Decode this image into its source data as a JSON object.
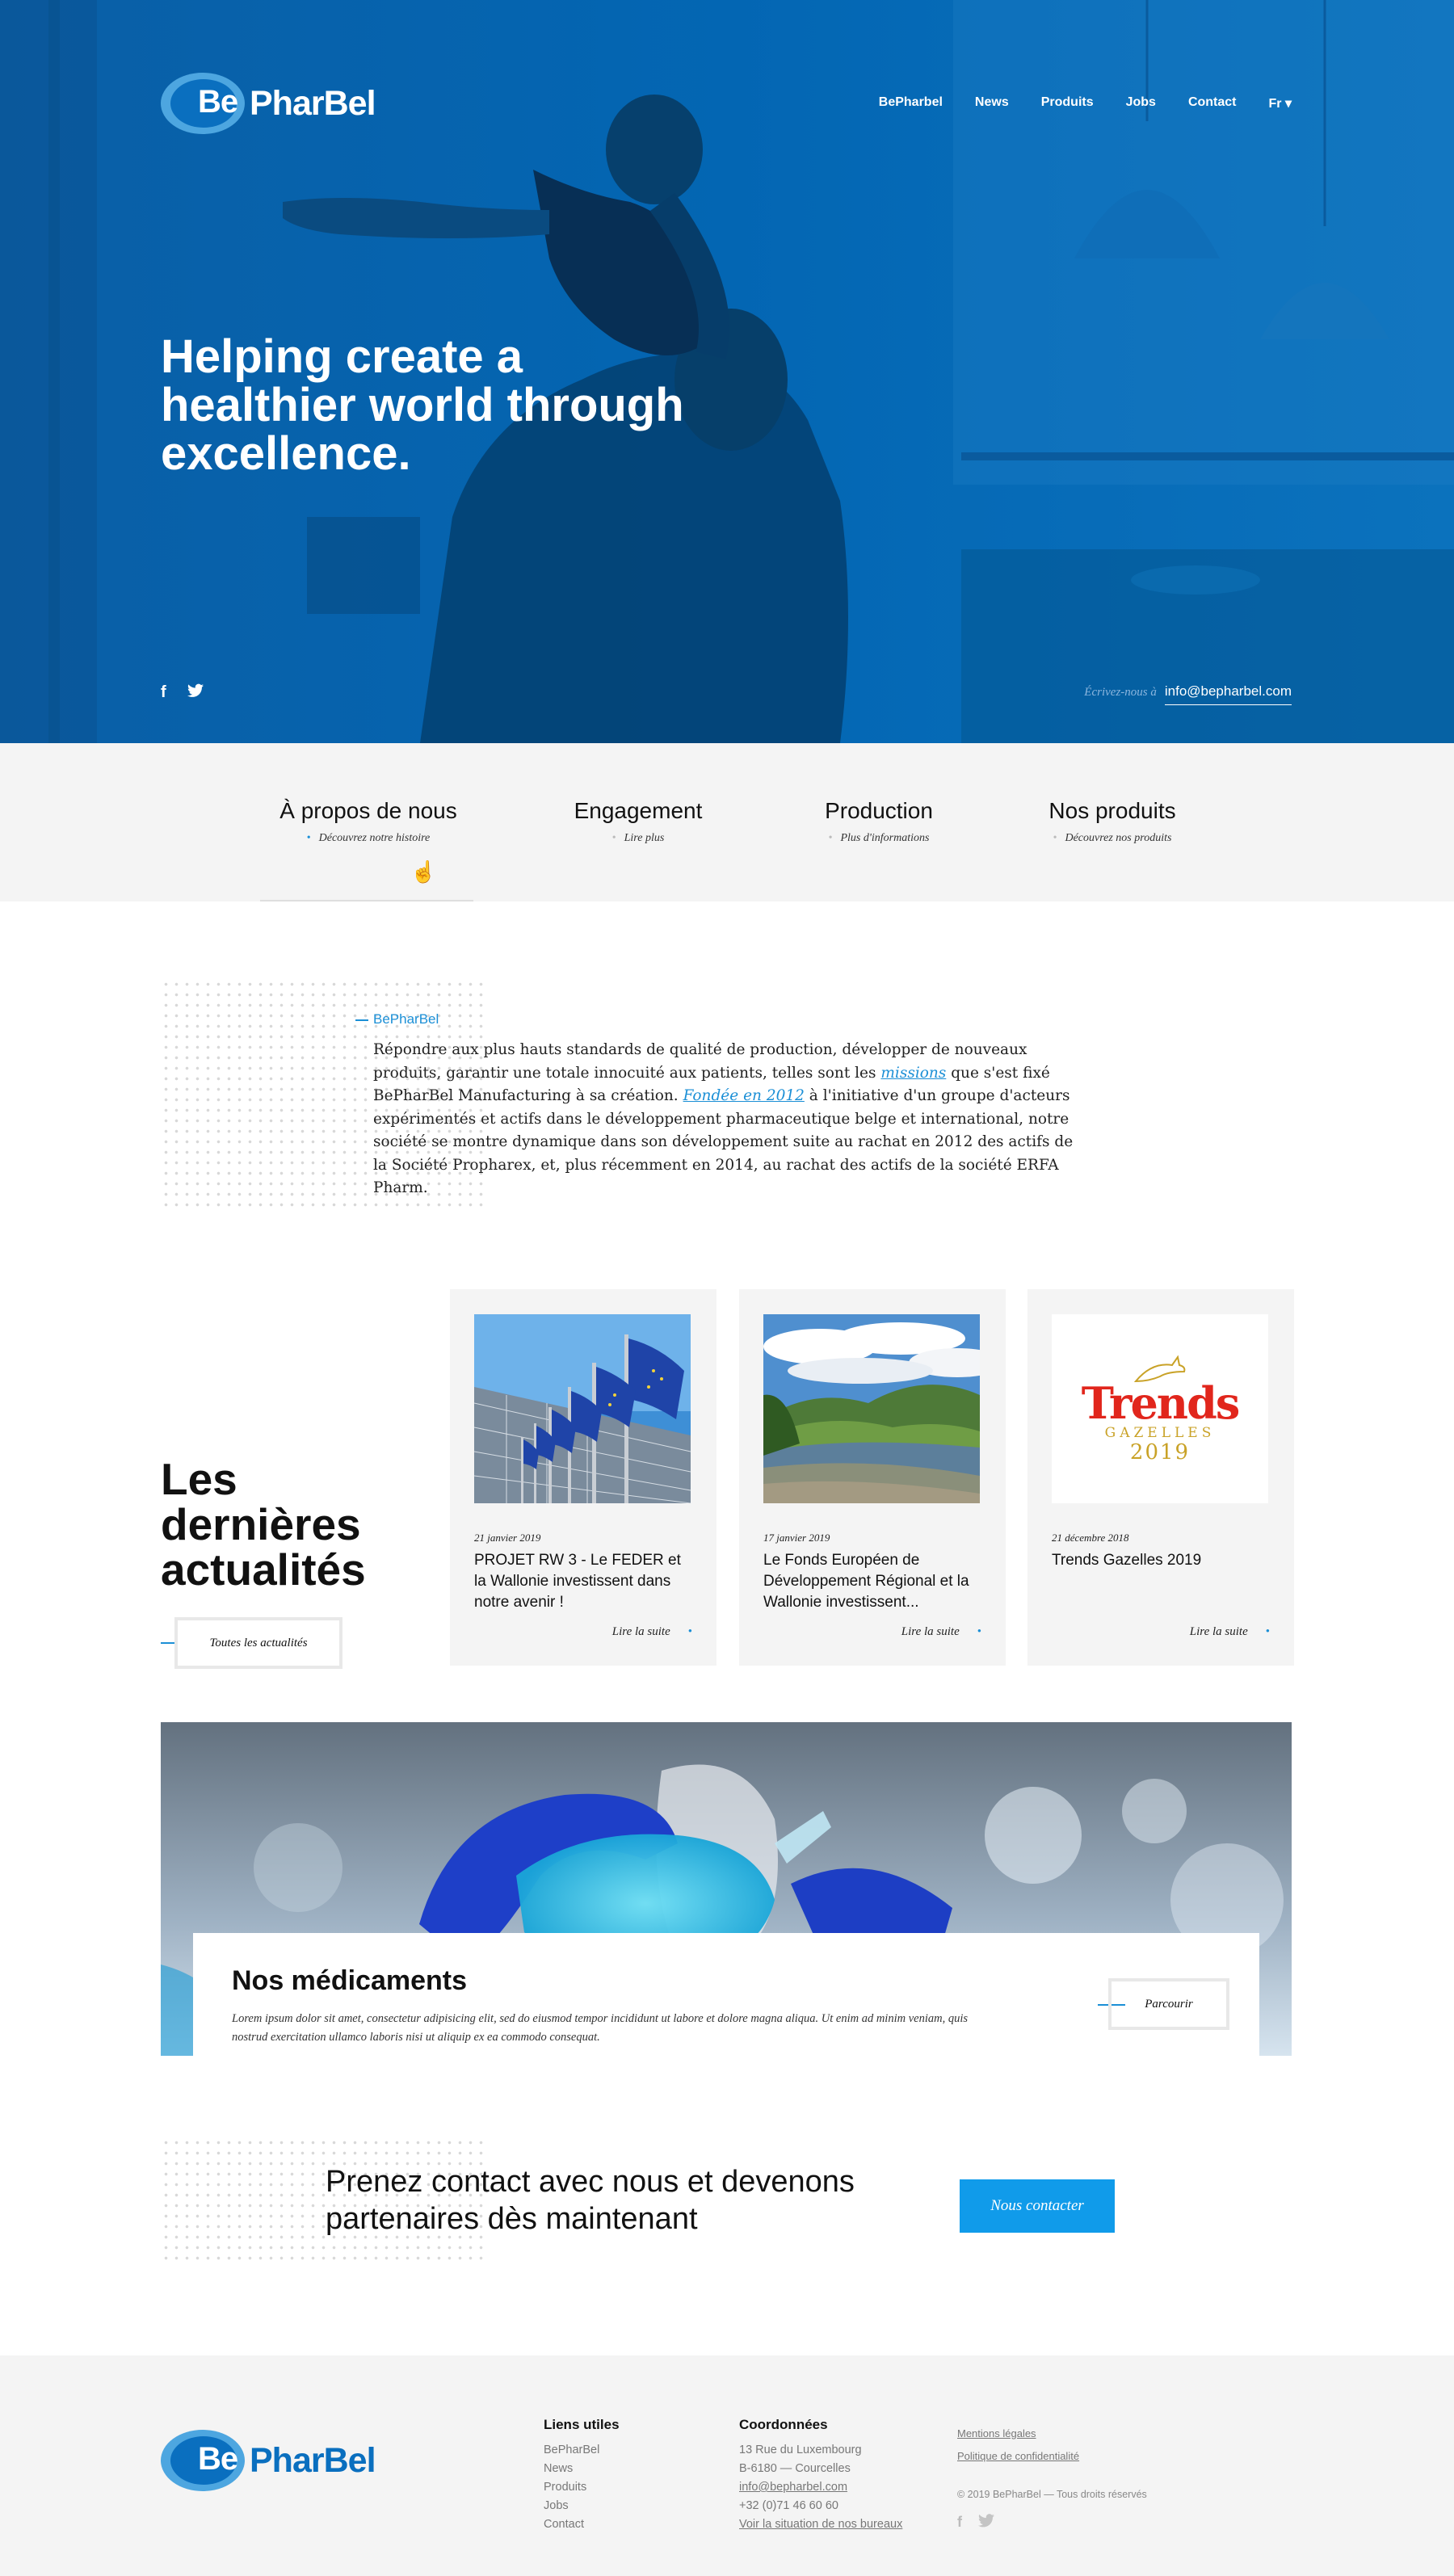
{
  "brand": {
    "be": "Be",
    "name": "PharBel",
    "primary_color": "#0366b3",
    "accent_color": "#1b8fd6",
    "button_color": "#109bea"
  },
  "nav": {
    "items": [
      "BePharbel",
      "News",
      "Produits",
      "Jobs",
      "Contact",
      "Fr ▾"
    ]
  },
  "hero": {
    "title": "Helping create a healthier world through excellence.",
    "social_icons": [
      "facebook-icon",
      "twitter-icon"
    ],
    "email_label": "Écrivez-nous à",
    "email": "info@bepharbel.com"
  },
  "features": [
    {
      "title": "À propos de nous",
      "subtitle": "Découvrez notre histoire",
      "active": true
    },
    {
      "title": "Engagement",
      "subtitle": "Lire plus",
      "active": false
    },
    {
      "title": "Production",
      "subtitle": "Plus d'informations",
      "active": false
    },
    {
      "title": "Nos produits",
      "subtitle": "Découvrez nos produits",
      "active": false
    }
  ],
  "about": {
    "kicker": "BePharBel",
    "text_1": "Répondre aux plus hauts standards de qualité de production, développer de nouveaux produits, garantir une totale innocuité aux patients, telles sont les ",
    "link_1": "missions",
    "text_2": " que s'est fixé BePharBel Manufacturing à sa création. ",
    "link_2": "Fondée en 2012",
    "text_3": " à l'initiative d'un groupe d'acteurs expérimentés et actifs dans le développement pharmaceutique belge et international, notre société se montre dynamique dans son développement suite au rachat en 2012 des actifs de la Société Propharex, et, plus récemment en 2014, au rachat des actifs de la société ERFA Pharm."
  },
  "news": {
    "heading_1": "Les",
    "heading_2": "dernières",
    "heading_3": "actualités",
    "all_button": "Toutes les actualités",
    "cards": [
      {
        "date": "21 janvier 2019",
        "title": "PROJET RW 3 - Le FEDER et la Wallonie investissent dans notre avenir !",
        "more": "Lire la suite"
      },
      {
        "date": "17 janvier 2019",
        "title": "Le Fonds Européen de Développement Régional et la Wallonie investissent...",
        "more": "Lire la suite"
      },
      {
        "date": "21 décembre 2018",
        "title": "Trends Gazelles 2019",
        "more": "Lire la suite"
      }
    ],
    "trends_logo": {
      "word": "Trends",
      "sub": "GAZELLES",
      "year": "2019"
    }
  },
  "medicines": {
    "title": "Nos médicaments",
    "description": "Lorem ipsum dolor sit amet, consectetur adipisicing elit, sed do eiusmod tempor incididunt ut labore et dolore magna aliqua. Ut enim ad minim veniam, quis nostrud exercitation ullamco laboris nisi ut aliquip ex ea commodo consequat.",
    "button": "Parcourir"
  },
  "contact": {
    "line_1": "Prenez contact avec nous et devenons",
    "line_2": "partenaires dès maintenant",
    "button": "Nous contacter"
  },
  "footer": {
    "links_title": "Liens utiles",
    "links": [
      "BePharBel",
      "News",
      "Produits",
      "Jobs",
      "Contact"
    ],
    "contact_title": "Coordonnées",
    "address_1": "13 Rue du Luxembourg",
    "address_2": "B-6180 — Courcelles",
    "email": "info@bepharbel.com",
    "phone": "+32 (0)71 46 60 60",
    "map_link": "Voir la situation de nos bureaux",
    "legal": "Mentions légales",
    "privacy": "Politique de confidentialité",
    "copyright": "© 2019 BePharBel — Tous droits réservés"
  }
}
